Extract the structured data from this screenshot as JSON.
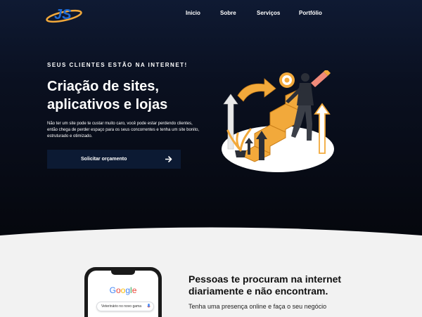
{
  "brand": {
    "logo_text": "JS"
  },
  "nav": {
    "items": [
      {
        "label": "Inicio"
      },
      {
        "label": "Sobre"
      },
      {
        "label": "Serviços"
      },
      {
        "label": "Portfólio"
      }
    ]
  },
  "hero": {
    "eyebrow": "SEUS CLIENTES ESTÃO NA INTERNET!",
    "headline_line1": "Criação de sites,",
    "headline_line2": "aplicativos e lojas",
    "description": "Não ter um site pode te custar muito caro, você pode estar perdendo clientes, então chega de perder espaço para os seus concorrentes e tenha um site bonito, estruturado e otimizado.",
    "cta_label": "Solicitar orçamento"
  },
  "section2": {
    "title_line1": "Pessoas te procuram na internet",
    "title_line2": "diariamente e não encontram.",
    "text": "Tenha uma presença online e faça o seu negócio",
    "phone": {
      "search_brand": "Google",
      "search_query": "Veterinário no novo gama"
    }
  },
  "colors": {
    "hero_bg": "#05070d",
    "accent_orange": "#f2a93b",
    "logo_blue": "#1e6bd6",
    "cta_bg": "#0c1a33"
  }
}
